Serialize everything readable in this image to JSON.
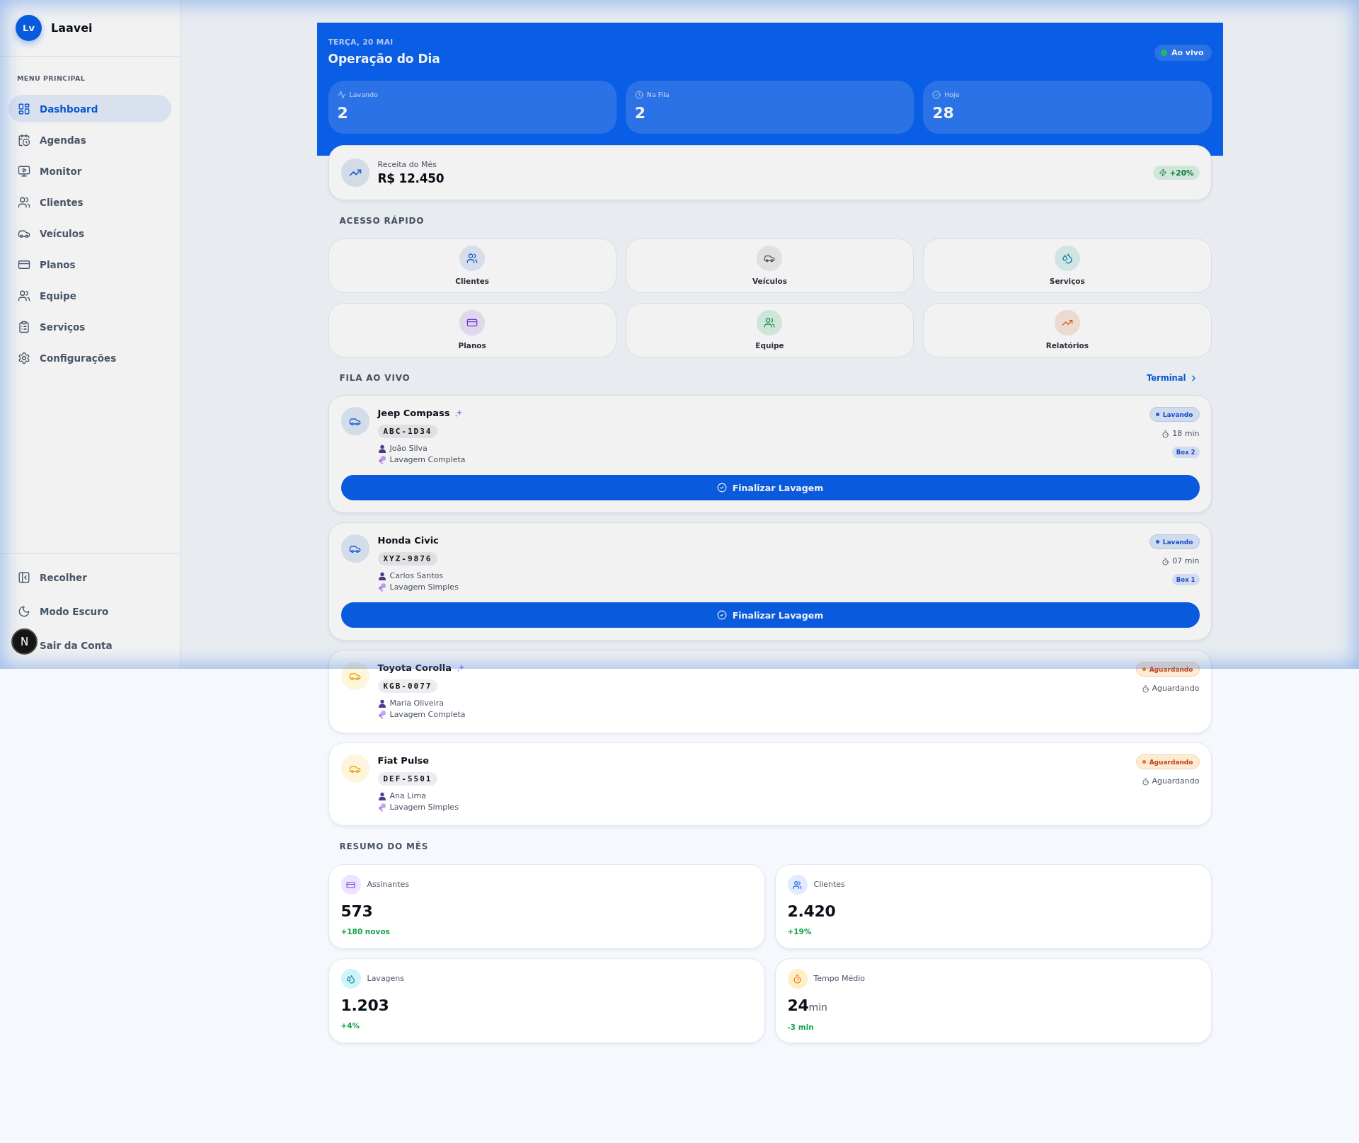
{
  "sidebar": {
    "logo": {
      "initials": "Lv",
      "name": "Laavei"
    },
    "section_title": "MENU PRINCIPAL",
    "items": [
      {
        "label": "Dashboard",
        "selected": true
      },
      {
        "label": "Agendas",
        "selected": false
      },
      {
        "label": "Monitor",
        "selected": false
      },
      {
        "label": "Clientes",
        "selected": false
      },
      {
        "label": "Veículos",
        "selected": false
      },
      {
        "label": "Planos",
        "selected": false
      },
      {
        "label": "Equipe",
        "selected": false
      },
      {
        "label": "Serviços",
        "selected": false
      },
      {
        "label": "Configurações",
        "selected": false
      }
    ],
    "footer_items": [
      {
        "label": "Recolher"
      },
      {
        "label": "Modo Escuro"
      },
      {
        "label": "Sair da Conta"
      }
    ]
  },
  "dev_tools_button": {
    "label": "N"
  },
  "header": {
    "date": "TERÇA, 20 MAI",
    "title": "Operação do Dia",
    "live_badge": "Ao vivo",
    "stats": [
      {
        "label": "Lavando",
        "value": "2"
      },
      {
        "label": "Na Fila",
        "value": "2"
      },
      {
        "label": "Hoje",
        "value": "28"
      }
    ]
  },
  "revenue": {
    "label": "Receita do Mês",
    "value": "R$ 12.450",
    "change": "+20%"
  },
  "quick_access": {
    "title": "ACESSO RÁPIDO",
    "items": [
      {
        "label": "Clientes"
      },
      {
        "label": "Veículos"
      },
      {
        "label": "Serviços"
      },
      {
        "label": "Planos"
      },
      {
        "label": "Equipe"
      },
      {
        "label": "Relatórios"
      }
    ]
  },
  "queue": {
    "title": "FILA AO VIVO",
    "link": "Terminal",
    "items": [
      {
        "kind": "washing",
        "vehicle": "Jeep Compass",
        "premium": true,
        "plate": "ABC-1D34",
        "customer": "João Silva",
        "service": "Lavagem Completa",
        "status": "Lavando",
        "time": "18 min",
        "bay": "Box 2",
        "action": "Finalizar Lavagem"
      },
      {
        "kind": "washing",
        "vehicle": "Honda Civic",
        "premium": false,
        "plate": "XYZ-9876",
        "customer": "Carlos Santos",
        "service": "Lavagem Simples",
        "status": "Lavando",
        "time": "07 min",
        "bay": "Box 1",
        "action": "Finalizar Lavagem"
      },
      {
        "kind": "waiting",
        "vehicle": "Toyota Corolla",
        "premium": true,
        "plate": "KGB-0077",
        "customer": "Maria Oliveira",
        "service": "Lavagem Completa",
        "status": "Aguardando",
        "time": "Aguardando"
      },
      {
        "kind": "waiting",
        "vehicle": "Fiat Pulse",
        "premium": false,
        "plate": "DEF-5501",
        "customer": "Ana Lima",
        "service": "Lavagem Simples",
        "status": "Aguardando",
        "time": "Aguardando"
      }
    ]
  },
  "summary": {
    "title": "RESUMO DO MÊS",
    "cards": [
      {
        "label": "Assinantes",
        "value": "573",
        "change": "+180 novos"
      },
      {
        "label": "Clientes",
        "value": "2.420",
        "change": "+19%"
      },
      {
        "label": "Lavagens",
        "value": "1.203",
        "change": "+4%"
      },
      {
        "label": "Tempo Médio",
        "value": "24",
        "unit": "min",
        "change": "-3 min"
      }
    ]
  }
}
